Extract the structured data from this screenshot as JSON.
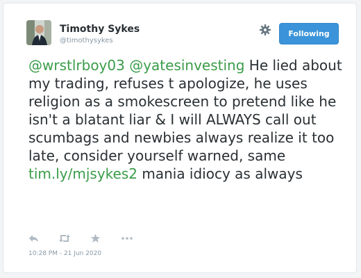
{
  "user": {
    "name": "Timothy Sykes",
    "handle": "@timothysykes"
  },
  "follow_button": {
    "label": "Following"
  },
  "tweet": {
    "mention1": "@wrstlrboy03",
    "mention2": "@yatesinvesting",
    "text1": " He lied about my trading, refuses t apologize, he uses religion as a smokescreen to pretend like he isn't a blatant liar & I will ALWAYS call out scumbags and newbies always realize it too late, consider yourself warned, same ",
    "link": "tim.ly/mjsykes2",
    "text2": " mania idiocy as always"
  },
  "actions": [
    "reply-icon",
    "retweet-icon",
    "favorite-icon",
    "more-icon"
  ],
  "timestamp": "10:28 PM - 21 Jun 2020",
  "colors": {
    "link": "#3a9c4a",
    "button": "#3b94d9",
    "text": "#292f33",
    "muted": "#8899a6"
  }
}
